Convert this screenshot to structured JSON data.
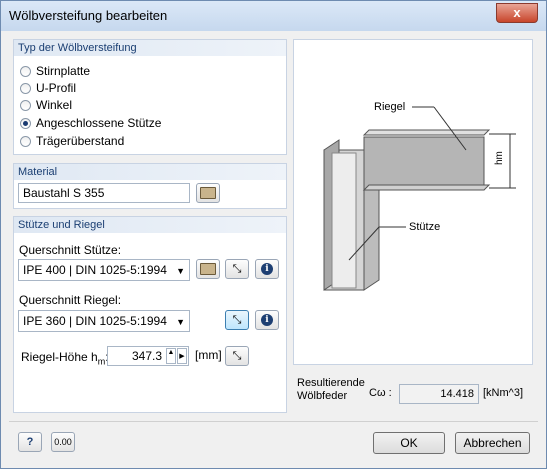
{
  "window": {
    "title": "Wölbversteifung bearbeiten",
    "close_label": "x"
  },
  "type_group": {
    "header": "Typ der Wölbversteifung",
    "options": [
      {
        "label": "Stirnplatte",
        "selected": false
      },
      {
        "label": "U-Profil",
        "selected": false
      },
      {
        "label": "Winkel",
        "selected": false
      },
      {
        "label": "Angeschlossene Stütze",
        "selected": true
      },
      {
        "label": "Trägerüberstand",
        "selected": false
      }
    ]
  },
  "material_group": {
    "header": "Material",
    "value": "Baustahl S 355"
  },
  "support_group": {
    "header": "Stütze und Riegel",
    "column_label": "Querschnitt Stütze:",
    "column_value": "IPE 400 | DIN 1025-5:1994",
    "beam_label": "Querschnitt Riegel:",
    "beam_value": "IPE 360 | DIN 1025-5:1994",
    "height_label": "Riegel-Höhe h",
    "height_sub": "m",
    "height_colon": ":",
    "height_value": "347.3",
    "height_unit": "[mm]"
  },
  "figure": {
    "label_riegel": "Riegel",
    "label_stuetze": "Stütze",
    "label_hm": "hm"
  },
  "result": {
    "label_line1": "Resultierende",
    "label_line2": "Wölbfeder",
    "symbol": "Cω :",
    "value": "14.418",
    "unit": "[kNm^3]"
  },
  "footer": {
    "ok_label": "OK",
    "cancel_label": "Abbrechen"
  }
}
